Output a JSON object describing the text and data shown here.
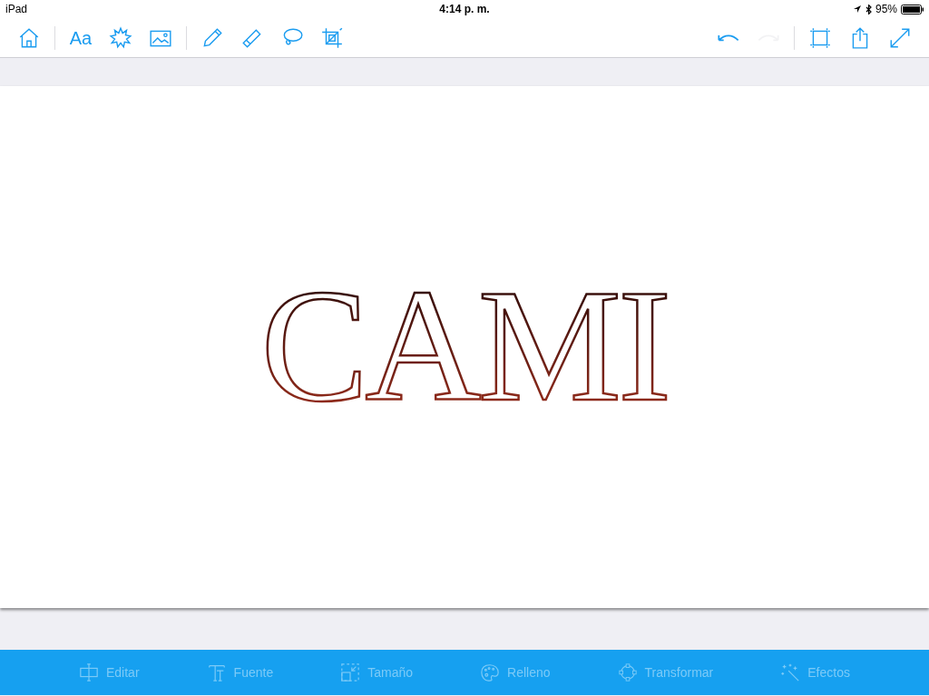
{
  "status_bar": {
    "device": "iPad",
    "time": "4:14 p. m.",
    "battery": "95%"
  },
  "toolbar": {
    "left": [
      {
        "kind": "home",
        "disabled": false
      },
      {
        "kind": "text",
        "label": "Aa",
        "disabled": false
      },
      {
        "kind": "burst",
        "disabled": false
      },
      {
        "kind": "image",
        "disabled": false
      },
      {
        "kind": "pencil",
        "disabled": false
      },
      {
        "kind": "eraser",
        "disabled": false
      },
      {
        "kind": "lasso",
        "disabled": false
      },
      {
        "kind": "crop",
        "disabled": false
      }
    ],
    "right": [
      {
        "kind": "undo",
        "disabled": false
      },
      {
        "kind": "redo",
        "disabled": true
      },
      {
        "kind": "artboard",
        "disabled": false
      },
      {
        "kind": "share",
        "disabled": false
      },
      {
        "kind": "expand",
        "disabled": false
      }
    ]
  },
  "canvas": {
    "text": "CAMI"
  },
  "bottom_bar": [
    {
      "kind": "edit",
      "label": "Editar",
      "disabled": true
    },
    {
      "kind": "font",
      "label": "Fuente",
      "disabled": true
    },
    {
      "kind": "size",
      "label": "Tamaño",
      "disabled": true
    },
    {
      "kind": "fill",
      "label": "Relleno",
      "disabled": true
    },
    {
      "kind": "transform",
      "label": "Transformar",
      "disabled": true
    },
    {
      "kind": "effects",
      "label": "Efectos",
      "disabled": true
    }
  ]
}
